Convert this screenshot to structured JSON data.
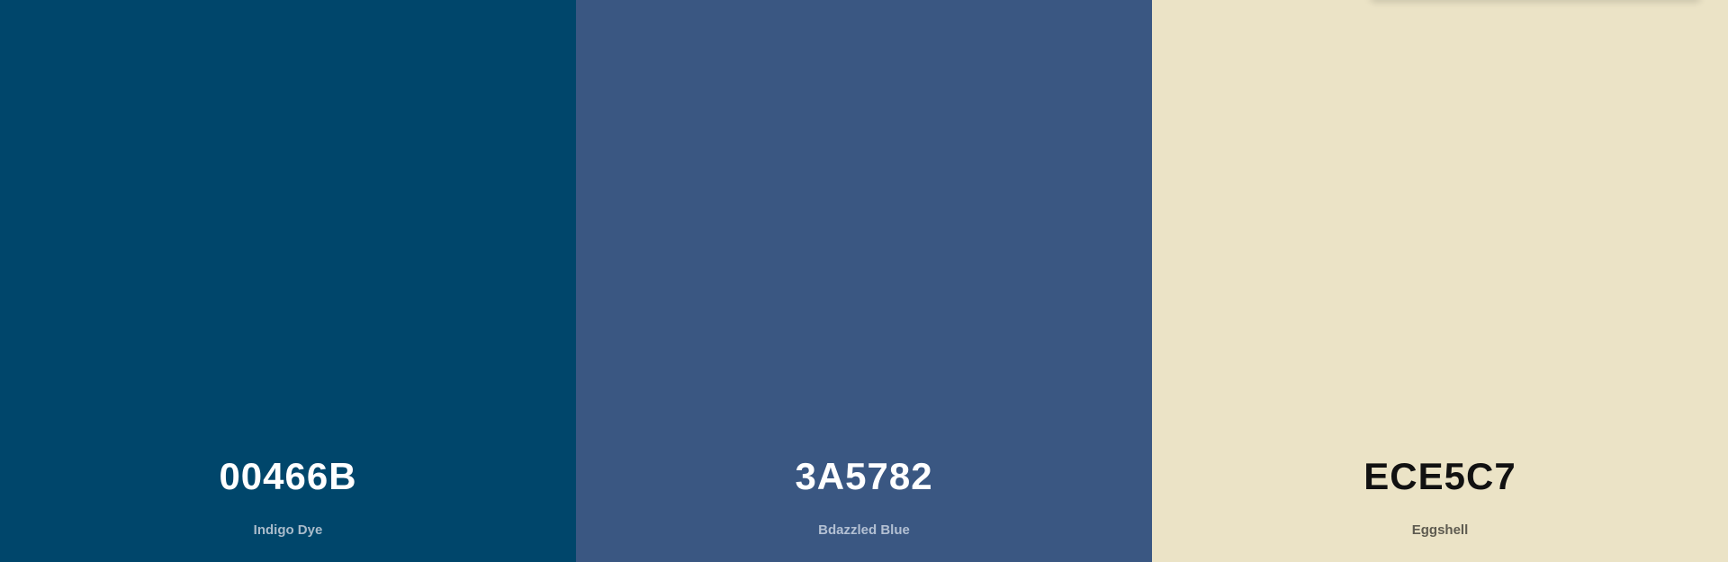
{
  "swatches": [
    {
      "hex": "00466B",
      "name": "Indigo Dye",
      "bg": "#00466B",
      "hex_color": "#FFFFFF",
      "name_color": "#A9BCCB"
    },
    {
      "hex": "3A5782",
      "name": "Bdazzled Blue",
      "bg": "#3A5782",
      "hex_color": "#FFFFFF",
      "name_color": "#B3C0D3"
    },
    {
      "hex": "ECE5C7",
      "name": "Eggshell",
      "bg": "#EBE3C6",
      "hex_color": "#111111",
      "name_color": "#5E5B50"
    }
  ]
}
